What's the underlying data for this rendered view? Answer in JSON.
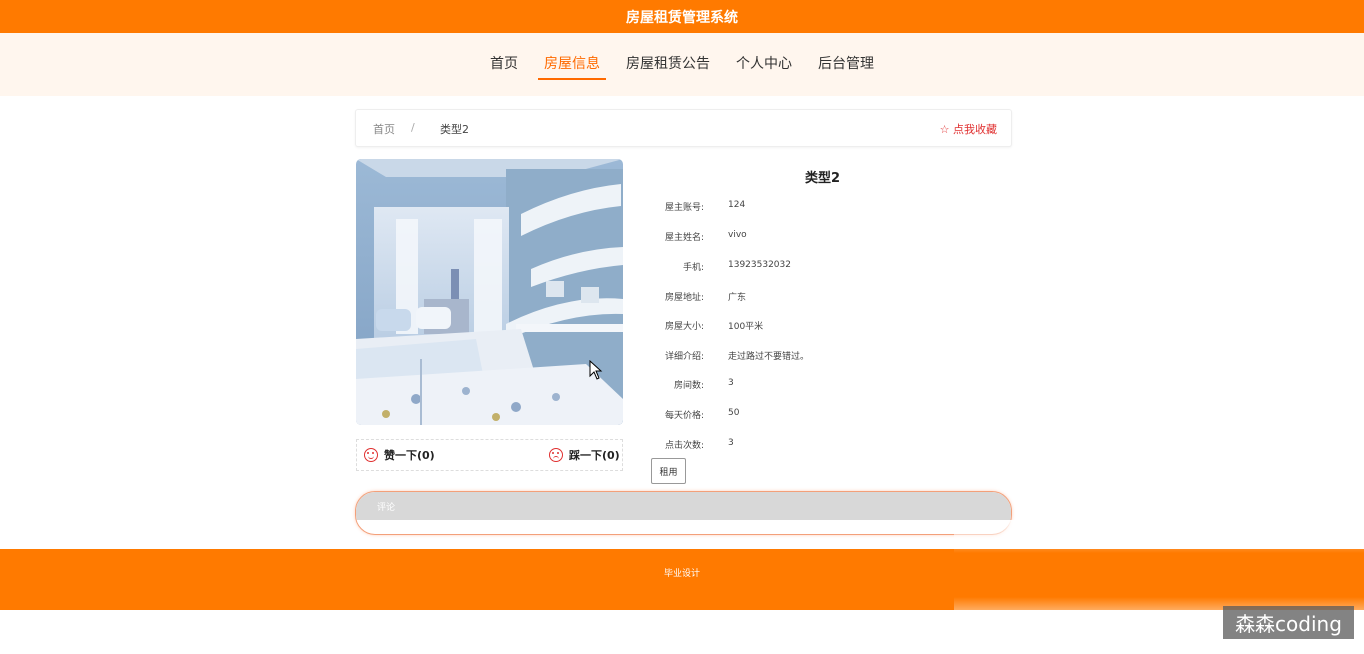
{
  "header": {
    "title": "房屋租赁管理系统"
  },
  "nav": {
    "items": [
      {
        "label": "首页",
        "active": false
      },
      {
        "label": "房屋信息",
        "active": true
      },
      {
        "label": "房屋租赁公告",
        "active": false
      },
      {
        "label": "个人中心",
        "active": false
      },
      {
        "label": "后台管理",
        "active": false
      }
    ]
  },
  "breadcrumb": {
    "home": "首页",
    "separator": "/",
    "current": "类型2",
    "favorite": "☆ 点我收藏"
  },
  "votes": {
    "like": "赞一下(0)",
    "dislike": "踩一下(0)"
  },
  "detail": {
    "title": "类型2",
    "fields": [
      {
        "label": "屋主账号:",
        "value": "124"
      },
      {
        "label": "屋主姓名:",
        "value": "vivo"
      },
      {
        "label": "手机:",
        "value": "13923532032"
      },
      {
        "label": "房屋地址:",
        "value": "广东"
      },
      {
        "label": "房屋大小:",
        "value": "100平米"
      },
      {
        "label": "详细介绍:",
        "value": "走过路过不要错过。"
      },
      {
        "label": "房间数:",
        "value": "3"
      },
      {
        "label": "每天价格:",
        "value": "50"
      },
      {
        "label": "点击次数:",
        "value": "3"
      }
    ],
    "rent_button": "租用"
  },
  "comment": {
    "label": "评论"
  },
  "footer": {
    "text": "毕业设计"
  },
  "watermark": "森森coding",
  "colors": {
    "primary": "#ff7a00",
    "nav_bg": "#fff6ee",
    "accent_red": "#e03030"
  }
}
